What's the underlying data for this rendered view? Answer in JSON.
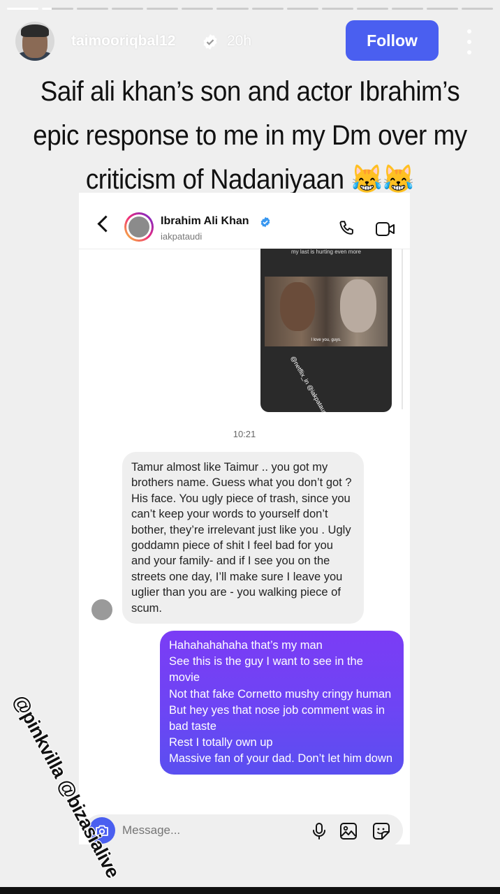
{
  "story": {
    "progress_segments": [
      1,
      0.3,
      0,
      0,
      0,
      0,
      0,
      0,
      0,
      0,
      0,
      0,
      0,
      0
    ],
    "username": "taimooriqbal12",
    "time_ago": "20h",
    "follow_label": "Follow",
    "caption": "Saif ali khan’s son and actor Ibrahim’s epic response to me in my Dm over my criticism of Nadaniyaan 😹😹",
    "watermark": "@pinkvilla @bizasialive"
  },
  "dm": {
    "name": "Ibrahim Ali Khan",
    "handle": "iakpataudi",
    "story_caption": "my last is hurting even more",
    "story_subtitle": "I love you, guys.",
    "story_tag": "@netflix_in @iakpataudi",
    "timestamp": "10:21",
    "incoming": "Tamur almost like Taimur .. you got my brothers name. Guess what you don’t got ? His face. You ugly piece of trash, since you can’t keep your words to yourself don’t bother, they’re irrelevant just like you . Ugly goddamn piece of shit I feel bad for you and your family- and if I see you on the streets one day, I’ll make sure I leave you uglier than you are - you walking piece of scum.",
    "outgoing_lines": [
      "Hahahahahaha that’s my man",
      "See this is the guy I want to see in the movie",
      "Not that fake Cornetto mushy cringy human",
      "But hey yes that nose job comment was in bad taste",
      "Rest I totally own up",
      "Massive fan of your dad. Don’t let him down"
    ],
    "message_placeholder": "Message..."
  },
  "colors": {
    "accent": "#4a5ff0",
    "outgoing_bubble_top": "#7b3cf5",
    "outgoing_bubble_bottom": "#5a4ff0",
    "incoming_bubble": "#efefef"
  }
}
